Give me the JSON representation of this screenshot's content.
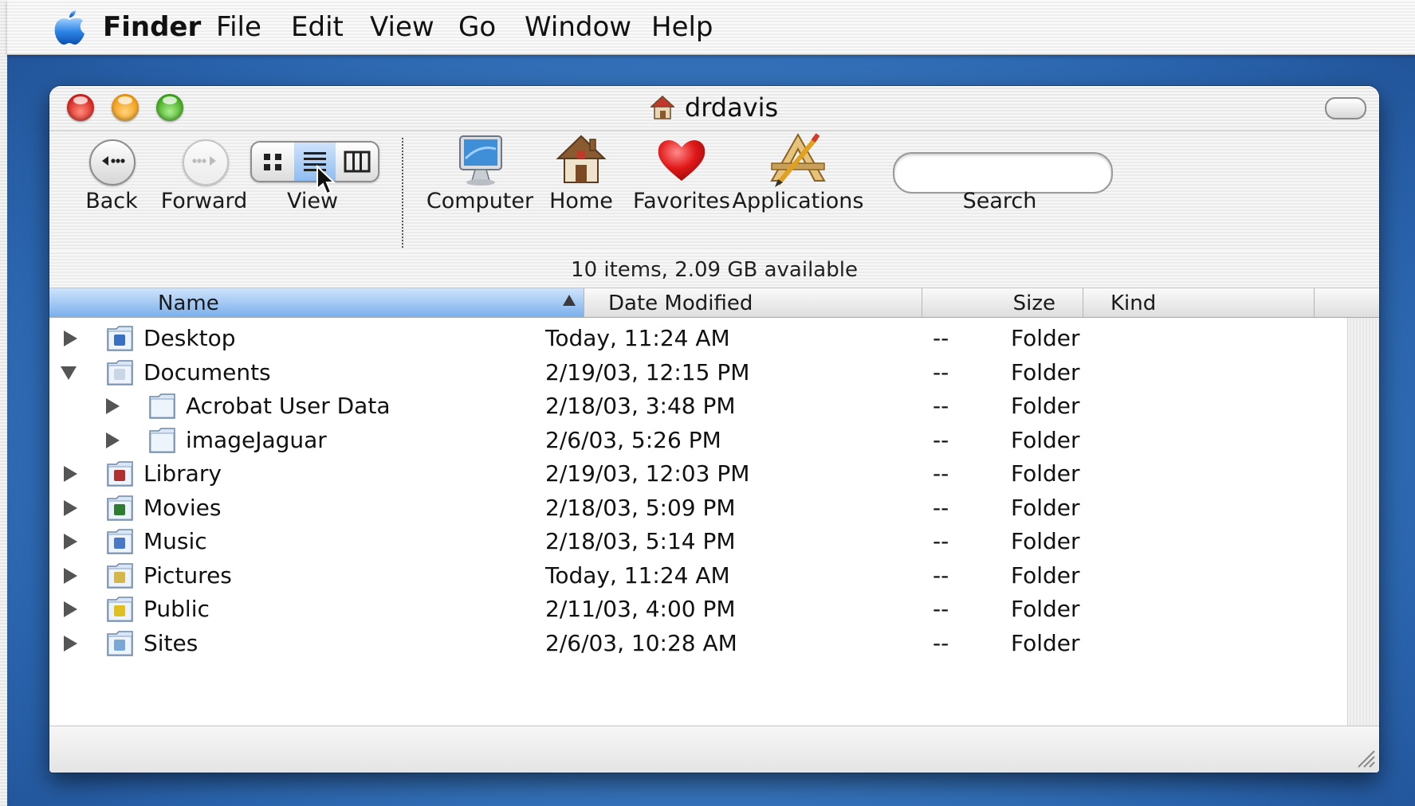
{
  "menubar": {
    "items": [
      "Finder",
      "File",
      "Edit",
      "View",
      "Go",
      "Window",
      "Help"
    ]
  },
  "window": {
    "title": "drdavis",
    "title_icon": "home-icon"
  },
  "toolbar": {
    "back_label": "Back",
    "forward_label": "Forward",
    "view_label": "View",
    "view_modes": [
      "icon",
      "list",
      "column"
    ],
    "view_selected": "list",
    "computer_label": "Computer",
    "home_label": "Home",
    "favorites_label": "Favorites",
    "applications_label": "Applications",
    "search_label": "Search",
    "search_value": ""
  },
  "status": {
    "text": "10 items, 2.09 GB available"
  },
  "columns": {
    "name": "Name",
    "date": "Date Modified",
    "size": "Size",
    "kind": "Kind",
    "sorted_by": "Name"
  },
  "rows": [
    {
      "name": "Desktop",
      "date": "Today, 11:24 AM",
      "size": "--",
      "kind": "Folder",
      "level": 0,
      "expanded": false,
      "icon": "desktop-folder-icon"
    },
    {
      "name": "Documents",
      "date": "2/19/03, 12:15 PM",
      "size": "--",
      "kind": "Folder",
      "level": 0,
      "expanded": true,
      "icon": "documents-folder-icon"
    },
    {
      "name": "Acrobat User Data",
      "date": "2/18/03, 3:48 PM",
      "size": "--",
      "kind": "Folder",
      "level": 1,
      "expanded": false,
      "icon": "folder-icon"
    },
    {
      "name": "imageJaguar",
      "date": "2/6/03, 5:26 PM",
      "size": "--",
      "kind": "Folder",
      "level": 1,
      "expanded": false,
      "icon": "folder-icon"
    },
    {
      "name": "Library",
      "date": "2/19/03, 12:03 PM",
      "size": "--",
      "kind": "Folder",
      "level": 0,
      "expanded": false,
      "icon": "library-folder-icon"
    },
    {
      "name": "Movies",
      "date": "2/18/03, 5:09 PM",
      "size": "--",
      "kind": "Folder",
      "level": 0,
      "expanded": false,
      "icon": "movies-folder-icon"
    },
    {
      "name": "Music",
      "date": "2/18/03, 5:14 PM",
      "size": "--",
      "kind": "Folder",
      "level": 0,
      "expanded": false,
      "icon": "music-folder-icon"
    },
    {
      "name": "Pictures",
      "date": "Today, 11:24 AM",
      "size": "--",
      "kind": "Folder",
      "level": 0,
      "expanded": false,
      "icon": "pictures-folder-icon"
    },
    {
      "name": "Public",
      "date": "2/11/03, 4:00 PM",
      "size": "--",
      "kind": "Folder",
      "level": 0,
      "expanded": false,
      "icon": "public-folder-icon"
    },
    {
      "name": "Sites",
      "date": "2/6/03, 10:28 AM",
      "size": "--",
      "kind": "Folder",
      "level": 0,
      "expanded": false,
      "icon": "sites-folder-icon"
    }
  ],
  "colors": {
    "desktop_blue": "#3e7fc6",
    "selection_blue": "#8fbdf0",
    "close_red": "#d3201a",
    "minimize_yellow": "#f09a10",
    "zoom_green": "#3ea61c"
  }
}
